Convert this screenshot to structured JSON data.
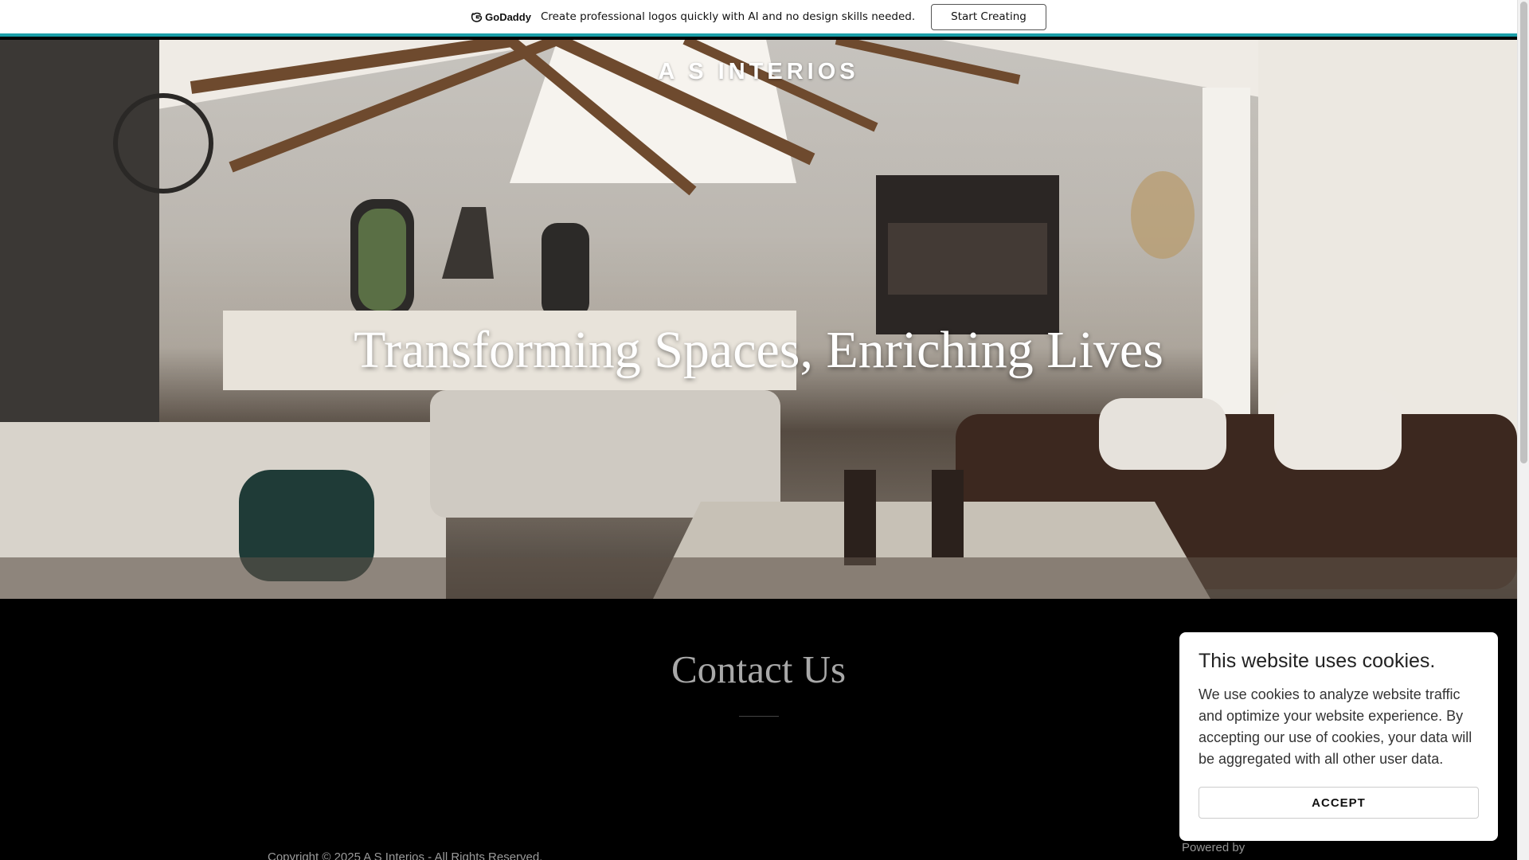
{
  "promo": {
    "logo_text": "GoDaddy",
    "message": "Create professional logos quickly with AI and no design skills needed.",
    "button_label": "Start Creating",
    "accent": "#1a9ea8"
  },
  "hero": {
    "site_title": "A S INTERIOS",
    "tagline": "Transforming Spaces, Enriching Lives"
  },
  "contact": {
    "title": "Contact Us",
    "copyright": "Copyright © 2025 A S Interios - All Rights Reserved.",
    "powered_by": "Powered by"
  },
  "cookie": {
    "title": "This website uses cookies.",
    "body": "We use cookies to analyze website traffic and optimize your website experience. By accepting our use of cookies, your data will be aggregated with all other user data.",
    "accept_label": "ACCEPT"
  },
  "icons": {
    "promo_logo": "godaddy-logo-icon"
  }
}
